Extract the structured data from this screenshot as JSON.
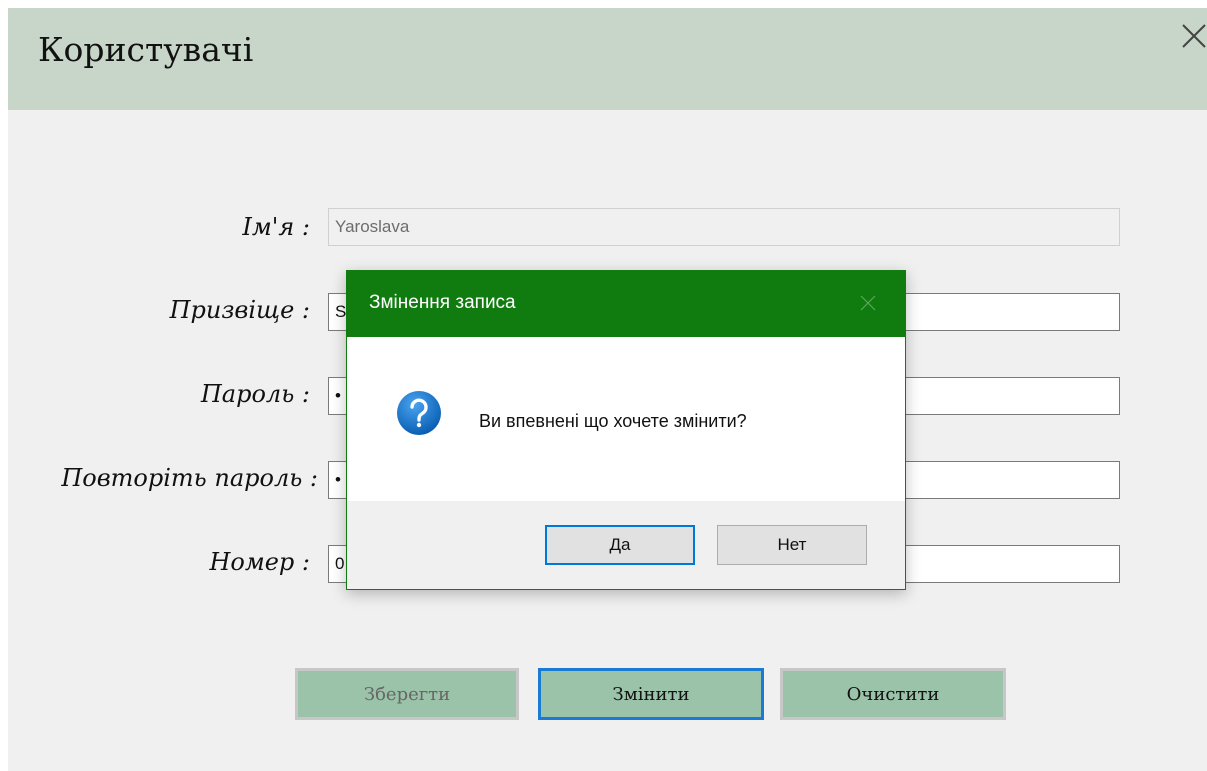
{
  "window": {
    "title": "Користувачі"
  },
  "form": {
    "name_label": "Ім'я :",
    "name_value": "Yaroslava",
    "surname_label": "Призвіще :",
    "surname_value": "S",
    "password_label": "Пароль :",
    "password_value": "•",
    "repeat_password_label": "Повторіть пароль :",
    "repeat_password_value": "•",
    "number_label": "Номер :",
    "number_value": "0"
  },
  "buttons": {
    "save_label": "Зберегти",
    "change_label": "Змінити",
    "clear_label": "Очистити"
  },
  "dialog": {
    "title": "Змінення записа",
    "message": "Ви впевнені що хочете змінити?",
    "yes_label": "Да",
    "no_label": "Нет",
    "icon": "question-icon"
  },
  "colors": {
    "header_bg": "#c8d6c9",
    "button_bg": "#9bc3a9",
    "dialog_accent": "#107c10",
    "focus_border": "#1a7ad4"
  }
}
